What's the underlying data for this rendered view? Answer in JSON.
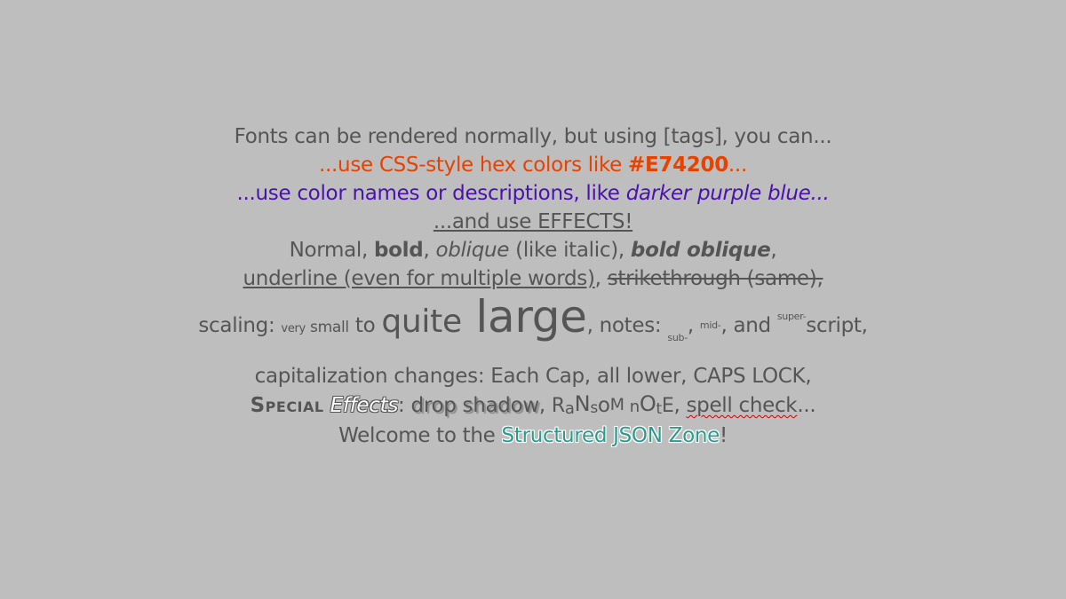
{
  "colors": {
    "background": "#bebebe",
    "text": "#555555",
    "orange": "#e74200",
    "purple": "#4a10b0",
    "zone": "#2d9a8c"
  },
  "lines": {
    "l1": "Fonts can be rendered normally, but using [tags], you can...",
    "l2_a": "...use CSS-style hex colors like ",
    "l2_b": "#E74200",
    "l2_c": "...",
    "l3_a": "...use color names or descriptions, like ",
    "l3_b": "darker purple blue...",
    "l4": "...and use EFFECTS!",
    "l5_a": "Normal, ",
    "l5_bold": "bold",
    "l5_c1": ", ",
    "l5_oblique": "oblique",
    "l5_d": " (like italic), ",
    "l5_boldoblique": "bold oblique",
    "l5_e": ",",
    "l6_underline": "underline (even for multiple words)",
    "l6_b": ", ",
    "l6_strike": "strikethrough (same),",
    "l7_a": "scaling: ",
    "l7_very": "very",
    "l7_small": " small",
    "l7_to": " to ",
    "l7_quite": "quite",
    "l7_large": " large",
    "l7_notes": ", notes: ",
    "l7_sub": "sub-",
    "l7_comma1": ", ",
    "l7_mid": "mid-",
    "l7_and": ", and ",
    "l7_super": "super-",
    "l7_script": "script,",
    "l8": "capitalization changes: Each Cap, all lower, CAPS LOCK,",
    "l9_special": "Special",
    "l9_effects": "Effects",
    "l9_colon": ": ",
    "l9_drop": "drop shadow",
    "l9_comma": ", ",
    "l9_ransom": "RaNsoM nOtE",
    "l9_comma2": ", ",
    "l9_spell": "spell check",
    "l9_dots": "...",
    "l10_a": "Welcome to the ",
    "l10_zone": "Structured JSON Zone",
    "l10_end": "!"
  }
}
